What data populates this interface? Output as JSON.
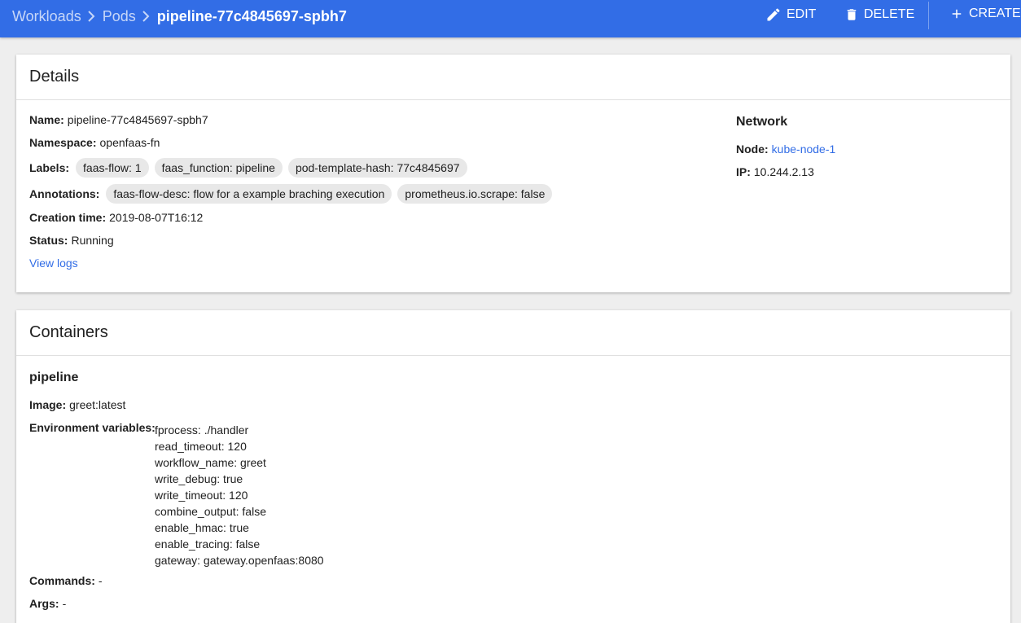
{
  "breadcrumb": {
    "workloads": "Workloads",
    "pods": "Pods",
    "current": "pipeline-77c4845697-spbh7"
  },
  "actions": {
    "edit": "EDIT",
    "delete": "DELETE",
    "create": "CREATE"
  },
  "colors": {
    "primary": "#326de6",
    "chip": "#e8e8e8"
  },
  "details": {
    "title": "Details",
    "name_label": "Name:",
    "name_value": "pipeline-77c4845697-spbh7",
    "namespace_label": "Namespace:",
    "namespace_value": "openfaas-fn",
    "labels_label": "Labels:",
    "labels": [
      "faas-flow: 1",
      "faas_function: pipeline",
      "pod-template-hash: 77c4845697"
    ],
    "annotations_label": "Annotations:",
    "annotations": [
      "faas-flow-desc: flow for a example braching execution",
      "prometheus.io.scrape: false"
    ],
    "creation_label": "Creation time:",
    "creation_value": "2019-08-07T16:12",
    "status_label": "Status:",
    "status_value": "Running",
    "view_logs": "View logs"
  },
  "network": {
    "title": "Network",
    "node_label": "Node:",
    "node_value": "kube-node-1",
    "ip_label": "IP:",
    "ip_value": "10.244.2.13"
  },
  "containers": {
    "title": "Containers",
    "name": "pipeline",
    "image_label": "Image:",
    "image_value": "greet:latest",
    "env_label": "Environment variables:",
    "env": [
      "fprocess: ./handler",
      "read_timeout: 120",
      "workflow_name: greet",
      "write_debug: true",
      "write_timeout: 120",
      "combine_output: false",
      "enable_hmac: true",
      "enable_tracing: false",
      "gateway: gateway.openfaas:8080"
    ],
    "commands_label": "Commands:",
    "commands_value": "-",
    "args_label": "Args:",
    "args_value": "-"
  }
}
